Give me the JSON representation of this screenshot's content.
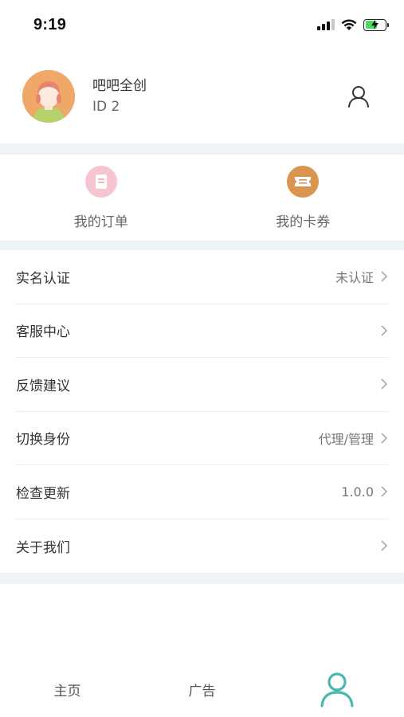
{
  "status_bar": {
    "time": "9:19",
    "icons": [
      "signal-icon",
      "wifi-icon",
      "battery-charging-icon"
    ]
  },
  "profile": {
    "name": "吧吧全创",
    "id_text": "ID 2",
    "avatar": "avatar-illustration",
    "action_icon": "user-outline-icon"
  },
  "quick_actions": [
    {
      "label": "我的订单",
      "icon": "order-icon",
      "color": "#f7c5d0"
    },
    {
      "label": "我的卡券",
      "icon": "coupon-icon",
      "color": "#d9954e"
    }
  ],
  "menu": [
    {
      "label": "实名认证",
      "value": "未认证"
    },
    {
      "label": "客服中心",
      "value": ""
    },
    {
      "label": "反馈建议",
      "value": ""
    },
    {
      "label": "切换身份",
      "value": "代理/管理"
    },
    {
      "label": "检查更新",
      "value": "1.0.0"
    },
    {
      "label": "关于我们",
      "value": ""
    }
  ],
  "tab_bar": {
    "tabs": [
      {
        "label": "主页"
      },
      {
        "label": "广告"
      },
      {
        "label": "",
        "icon": "profile-tab-icon",
        "active": true
      }
    ],
    "active_color": "#4bb8ad"
  },
  "colors": {
    "section_gap": "#eef3f6",
    "text_primary": "#333333",
    "text_secondary": "#777777"
  }
}
